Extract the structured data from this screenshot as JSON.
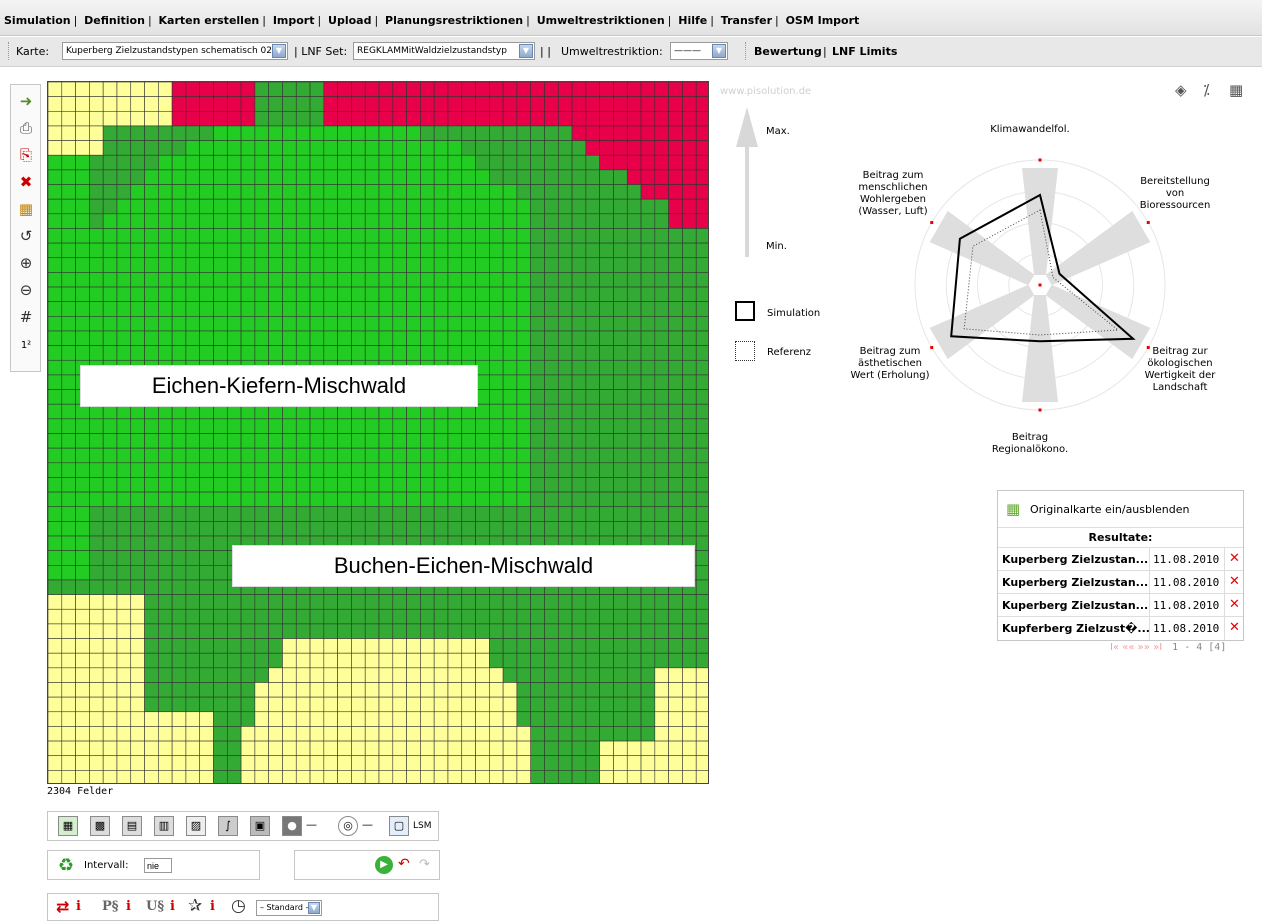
{
  "menu": {
    "items": [
      "Simulation",
      "Definition",
      "Karten erstellen",
      "Import",
      "Upload",
      "Planungsrestriktionen",
      "Umweltrestriktionen",
      "Hilfe",
      "Transfer",
      "OSM Import"
    ]
  },
  "toolbar": {
    "karte_label": "Karte:",
    "karte_value": "Kuperberg Zielzustandstypen schematisch 02",
    "lnf_label": "| LNF Set:",
    "lnf_value": "REGKLAMMitWaldzielzustandstyp",
    "separator": "| |",
    "umwelt_label": "Umweltrestriktion:",
    "umwelt_value": "———",
    "bewertung": "Bewertung",
    "pipe": "|",
    "lnf_limits": "LNF Limits"
  },
  "left_tools": [
    "export-icon",
    "save-icon",
    "pdf-icon",
    "delete-icon",
    "map-overlay-icon",
    "undo-icon",
    "zoom-in-icon",
    "zoom-out-icon",
    "grid-icon",
    "area-unit"
  ],
  "left_tools_area_text": "1²",
  "map": {
    "label_top": "Eichen-Kiefern-Mischwald",
    "label_bottom": "Buchen-Eichen-Mischwald",
    "felder": "2304 Felder",
    "colors": {
      "yellow": "#ffff99",
      "green": "#22cc22",
      "darkgreen": "#33aa33",
      "red": "#e8004a"
    }
  },
  "bottom_tools": {
    "lsm": "LSM",
    "intervall_label": "Intervall:",
    "intervall_value": "nie",
    "standard_value": "– Standard –",
    "labels": [
      "i",
      "P§",
      "i",
      "U§",
      "i",
      "i"
    ]
  },
  "watermark": "www.pisolution.de",
  "legend": {
    "max": "Max.",
    "min": "Min.",
    "simulation": "Simulation",
    "referenz": "Referenz"
  },
  "radar": {
    "axes": [
      "Klimawandelfol.",
      "Bereitstellung von Bioressourcen",
      "Beitrag zur ökologischen Wertigkeit der Landschaft",
      "Beitrag Regionalökono.",
      "Beitrag zum ästhetischen Wert (Erholung)",
      "Beitrag zum menschlichen Wohlergeben (Wasser, Luft)"
    ],
    "simulation": [
      0.72,
      0.18,
      0.86,
      0.45,
      0.82,
      0.74
    ],
    "referenz": [
      0.6,
      0.12,
      0.72,
      0.4,
      0.7,
      0.62
    ]
  },
  "results": {
    "toggle_label": "Originalkarte ein/ausblenden",
    "title": "Resultate:",
    "rows": [
      {
        "name": "Kuperberg Zielzustan...",
        "date": "11.08.2010"
      },
      {
        "name": "Kuperberg Zielzustan...",
        "date": "11.08.2010"
      },
      {
        "name": "Kuperberg Zielzustan...",
        "date": "11.08.2010"
      },
      {
        "name": "Kupferberg Zielzust�...",
        "date": "11.08.2010"
      }
    ],
    "pager_arrows": "I« «« »» »I",
    "pager_count": "1 - 4 [4]"
  }
}
